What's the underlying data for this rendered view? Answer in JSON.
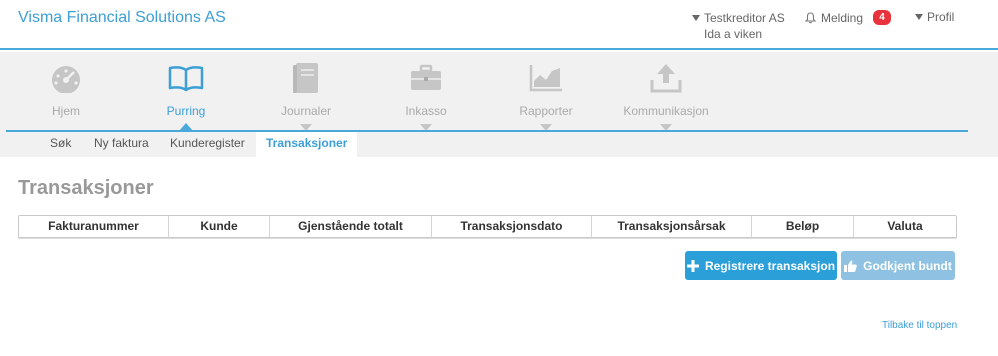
{
  "header": {
    "brand": "Visma Financial Solutions AS",
    "creditor_name": "Testkreditor AS",
    "creditor_user": "Ida a viken",
    "melding_label": "Melding",
    "melding_count": "4",
    "profil_label": "Profil"
  },
  "nav": {
    "items": [
      {
        "label": "Hjem",
        "icon": "speedometer-icon"
      },
      {
        "label": "Purring",
        "icon": "open-book-icon",
        "active": true
      },
      {
        "label": "Journaler",
        "icon": "notebook-icon"
      },
      {
        "label": "Inkasso",
        "icon": "briefcase-icon"
      },
      {
        "label": "Rapporter",
        "icon": "area-chart-icon"
      },
      {
        "label": "Kommunikasjon",
        "icon": "upload-icon"
      }
    ]
  },
  "subnav": {
    "items": [
      "Søk",
      "Ny faktura",
      "Kunderegister",
      "Transaksjoner"
    ],
    "active": "Transaksjoner"
  },
  "page": {
    "title": "Transaksjoner"
  },
  "table": {
    "columns": [
      "Fakturanummer",
      "Kunde",
      "Gjenstående totalt",
      "Transaksjonsdato",
      "Transaksjonsårsak",
      "Beløp",
      "Valuta"
    ]
  },
  "actions": {
    "register_label": "Registrere transaksjon",
    "approve_label": "Godkjent bundt"
  },
  "footer": {
    "back_to_top": "Tilbake til toppen"
  },
  "colors": {
    "accent": "#3c9fd6",
    "badge": "#e8323c",
    "primary_button": "#2a9fd8",
    "disabled_button": "#8fc2e2"
  }
}
